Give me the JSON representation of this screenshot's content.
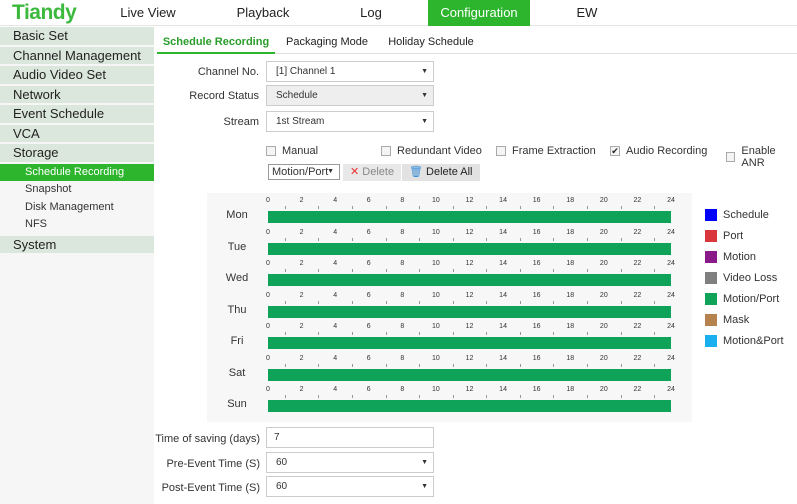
{
  "header": {
    "logo": "Tiandy",
    "nav": [
      "Live View",
      "Playback",
      "Log",
      "Configuration",
      "EW"
    ],
    "active": "Configuration"
  },
  "sidebar": {
    "items": [
      {
        "label": "Basic Set",
        "type": "main"
      },
      {
        "label": "Channel Management",
        "type": "main"
      },
      {
        "label": "Audio Video Set",
        "type": "main"
      },
      {
        "label": "Network",
        "type": "main"
      },
      {
        "label": "Event Schedule",
        "type": "main"
      },
      {
        "label": "VCA",
        "type": "main"
      },
      {
        "label": "Storage",
        "type": "main"
      },
      {
        "label": "Schedule Recording",
        "type": "sub",
        "active": true
      },
      {
        "label": "Snapshot",
        "type": "sub"
      },
      {
        "label": "Disk Management",
        "type": "sub"
      },
      {
        "label": "NFS",
        "type": "sub"
      },
      {
        "label": "System",
        "type": "main"
      }
    ]
  },
  "tabs": [
    "Schedule Recording",
    "Packaging Mode",
    "Holiday Schedule"
  ],
  "form": {
    "channel_label": "Channel No.",
    "channel_value": "[1] Channel 1",
    "status_label": "Record Status",
    "status_value": "Schedule",
    "stream_label": "Stream",
    "stream_value": "1st Stream"
  },
  "checkboxes": [
    {
      "label": "Manual",
      "checked": false
    },
    {
      "label": "Redundant Video",
      "checked": false
    },
    {
      "label": "Frame Extraction",
      "checked": false
    },
    {
      "label": "Audio Recording",
      "checked": true
    },
    {
      "label": "Enable ANR",
      "checked": false
    }
  ],
  "toolbar": {
    "type_value": "Motion/Port",
    "delete_label": "Delete",
    "delete_all_label": "Delete All"
  },
  "schedule": {
    "ticks": [
      "0",
      "2",
      "4",
      "6",
      "8",
      "10",
      "12",
      "14",
      "16",
      "18",
      "20",
      "22",
      "24"
    ],
    "days": [
      "Mon",
      "Tue",
      "Wed",
      "Thu",
      "Fri",
      "Sat",
      "Sun"
    ],
    "ranges": [
      [
        0,
        24
      ],
      [
        0,
        24
      ],
      [
        0,
        24
      ],
      [
        0,
        24
      ],
      [
        0,
        24
      ],
      [
        0,
        24
      ],
      [
        0,
        24
      ]
    ],
    "range_type": "Motion/Port"
  },
  "legend": [
    {
      "label": "Schedule",
      "color": "#0000ff"
    },
    {
      "label": "Port",
      "color": "#d9363e"
    },
    {
      "label": "Motion",
      "color": "#8b1a89"
    },
    {
      "label": "Video Loss",
      "color": "#808080"
    },
    {
      "label": "Motion/Port",
      "color": "#0fa35a"
    },
    {
      "label": "Mask",
      "color": "#b5814c"
    },
    {
      "label": "Motion&Port",
      "color": "#1ab0f0"
    }
  ],
  "bottom": {
    "saving_label": "Time of saving (days)",
    "saving_value": "7",
    "pre_label": "Pre-Event Time (S)",
    "pre_value": "60",
    "post_label": "Post-Event Time (S)",
    "post_value": "60"
  }
}
